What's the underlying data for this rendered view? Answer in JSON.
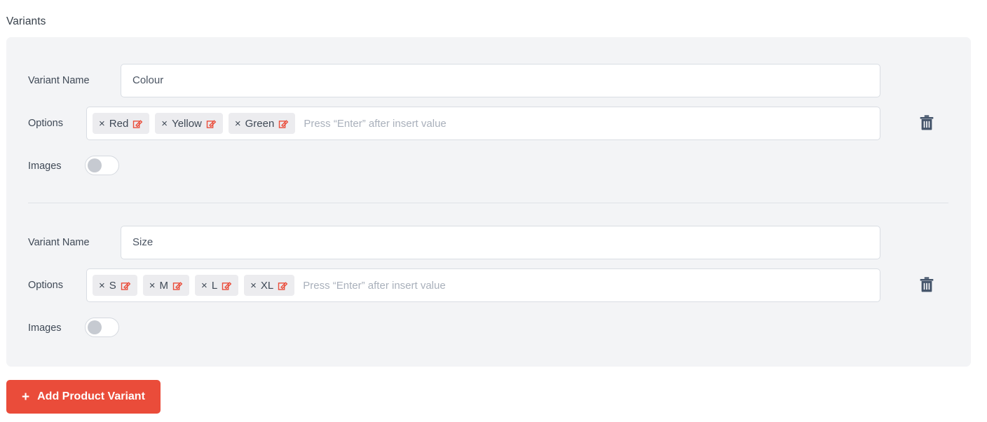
{
  "section": {
    "title": "Variants"
  },
  "labels": {
    "variant_name": "Variant Name",
    "options": "Options",
    "images": "Images"
  },
  "placeholders": {
    "variant_name": "Variant Name",
    "options": "Press “Enter” after insert value"
  },
  "icons": {
    "chip_remove": "close-x-icon",
    "chip_edit": "edit-pencil-icon",
    "delete": "trash-icon",
    "add": "plus-icon"
  },
  "colors": {
    "accent_red": "#ea4c3a",
    "panel_bg": "#f3f4f6",
    "chip_bg": "#ececef",
    "input_border": "#d9dde3",
    "text": "#3f4956",
    "placeholder": "#a9b0bb",
    "trash": "#44546a"
  },
  "variants": [
    {
      "name_value": "Colour",
      "options": [
        {
          "label": "Red"
        },
        {
          "label": "Yellow"
        },
        {
          "label": "Green"
        }
      ],
      "images_enabled": false
    },
    {
      "name_value": "Size",
      "options": [
        {
          "label": "S"
        },
        {
          "label": "M"
        },
        {
          "label": "L"
        },
        {
          "label": "XL"
        }
      ],
      "images_enabled": false
    }
  ],
  "add_button": {
    "plus": "+",
    "label": "Add Product Variant"
  }
}
